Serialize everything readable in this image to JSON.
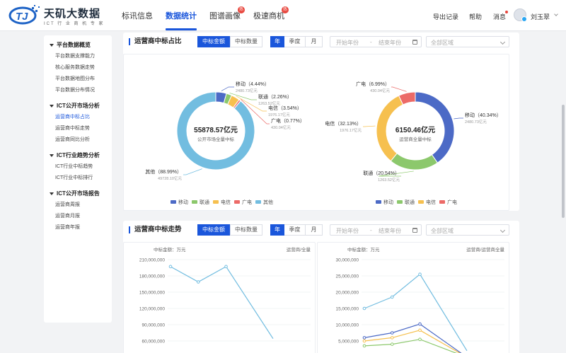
{
  "brand": {
    "title": "天矶大数据",
    "subtitle": "ICT 行 业 商 机 专 家"
  },
  "nav": [
    {
      "label": "标讯信息",
      "active": false
    },
    {
      "label": "数据统计",
      "active": true
    },
    {
      "label": "图谱画像",
      "active": false,
      "hot": "热"
    },
    {
      "label": "极速商机",
      "active": false,
      "hot": "热"
    }
  ],
  "header_right": {
    "export": "导出记录",
    "help": "帮助",
    "messages": "消息",
    "user": "刘玉翠"
  },
  "sidebar": [
    {
      "group": "平台数据概览",
      "items": [
        "平台数据支撑能力",
        "核心服务数据走势",
        "平台数据地图分布",
        "平台数据分布情况"
      ]
    },
    {
      "group": "ICT公开市场分析",
      "items": [
        "运营商中标占比",
        "运营商中标走势",
        "运营商同比分析"
      ]
    },
    {
      "group": "ICT行业趋势分析",
      "items": [
        "ICT行业中标趋势",
        "ICT行业中标排行"
      ]
    },
    {
      "group": "ICT公开市场报告",
      "items": [
        "运营商周报",
        "运营商月报",
        "运营商年报"
      ]
    }
  ],
  "active_sidebar_item": "运营商中标占比",
  "panel1": {
    "title": "运营商中标占比",
    "metric_tabs": [
      "中标金额",
      "中标数量"
    ],
    "period_tabs": [
      "年",
      "季度",
      "月"
    ],
    "start_placeholder": "开始年份",
    "end_placeholder": "结束年份",
    "region_placeholder": "全部区域"
  },
  "panel2": {
    "title": "运营商中标走势",
    "metric_tabs": [
      "中标金额",
      "中标数量"
    ],
    "period_tabs": [
      "年",
      "季度",
      "月"
    ],
    "start_placeholder": "开始年份",
    "end_placeholder": "结束年份",
    "region_placeholder": "全部区域"
  },
  "colors": {
    "移动": "#4c6ac6",
    "联通": "#8cc86c",
    "电信": "#f6c04f",
    "广电": "#ec6a67",
    "其他": "#72bde0",
    "accent": "#1a56db"
  },
  "chart_data": [
    {
      "type": "pie",
      "variant": "donut",
      "center_value": "55878.57亿元",
      "center_label": "公开市场全量中标",
      "slices": [
        {
          "name": "移动",
          "percent": 4.44,
          "pct_label": "移动（4.44%）",
          "amount": "2480.73亿元"
        },
        {
          "name": "联通",
          "percent": 2.26,
          "pct_label": "联通（2.26%）",
          "amount": "1263.52亿元"
        },
        {
          "name": "电信",
          "percent": 3.54,
          "pct_label": "电信（3.54%）",
          "amount": "1976.17亿元"
        },
        {
          "name": "广电",
          "percent": 0.77,
          "pct_label": "广电（0.77%）",
          "amount": "430.04亿元"
        },
        {
          "name": "其他",
          "percent": 88.99,
          "pct_label": "其他（88.99%）",
          "amount": "49728.10亿元"
        }
      ],
      "legend": [
        "移动",
        "联通",
        "电信",
        "广电",
        "其他"
      ]
    },
    {
      "type": "pie",
      "variant": "donut",
      "center_value": "6150.46亿元",
      "center_label": "运营商全量中标",
      "slices": [
        {
          "name": "移动",
          "percent": 40.34,
          "pct_label": "移动（40.34%）",
          "amount": "2480.73亿元"
        },
        {
          "name": "联通",
          "percent": 20.54,
          "pct_label": "联通（20.54%）",
          "amount": "1263.52亿元"
        },
        {
          "name": "电信",
          "percent": 32.13,
          "pct_label": "电信（32.13%）",
          "amount": "1976.17亿元"
        },
        {
          "name": "广电",
          "percent": 6.99,
          "pct_label": "广电（6.99%）",
          "amount": "430.04亿元"
        }
      ],
      "legend": [
        "移动",
        "联通",
        "电信",
        "广电"
      ]
    },
    {
      "type": "line",
      "unit_label": "中标金额：万元",
      "scope_label": "运营商/全量",
      "yticks": [
        "60,000,000",
        "90,000,000",
        "120,000,000",
        "150,000,000",
        "180,000,000",
        "210,000,000"
      ],
      "ylim": [
        0,
        210000000
      ],
      "series": [
        {
          "color": "#72bde0",
          "values": [
            195000000,
            162000000,
            195000000,
            40000000
          ]
        }
      ]
    },
    {
      "type": "line",
      "unit_label": "中标金额：万元",
      "scope_label": "运营商/运营商全量",
      "yticks": [
        "5,000,000",
        "10,000,000",
        "15,000,000",
        "20,000,000",
        "25,000,000",
        "30,000,000"
      ],
      "ylim": [
        0,
        30000000
      ],
      "series": [
        {
          "color": "#72bde0",
          "values": [
            15000000,
            18500000,
            25500000,
            2000000
          ]
        },
        {
          "color": "#4c6ac6",
          "values": [
            6000000,
            7500000,
            10200000,
            0
          ]
        },
        {
          "color": "#f6c04f",
          "values": [
            5000000,
            6000000,
            8300000,
            0
          ]
        },
        {
          "color": "#8cc86c",
          "values": [
            3500000,
            4000000,
            5500000,
            0
          ]
        }
      ]
    }
  ]
}
